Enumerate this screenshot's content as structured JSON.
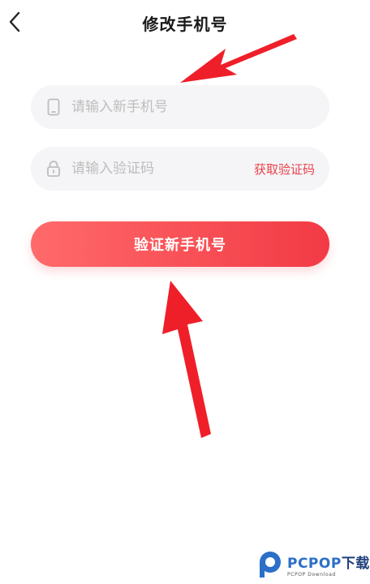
{
  "header": {
    "title": "修改手机号"
  },
  "form": {
    "phone_placeholder": "请输入新手机号",
    "code_placeholder": "请输入验证码",
    "get_code_label": "获取验证码",
    "submit_label": "验证新手机号"
  },
  "watermark": {
    "brand": "PCPOP",
    "brand_suffix": "下载",
    "sub": "PCPOP Download"
  },
  "colors": {
    "accent": "#f23a45",
    "arrow": "#ef1f2a",
    "field_bg": "#f5f5f7"
  },
  "icons": {
    "back": "chevron-left-icon",
    "phone": "phone-icon",
    "lock": "lock-icon"
  }
}
